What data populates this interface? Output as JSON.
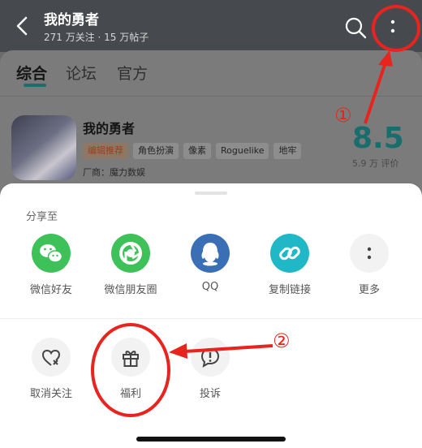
{
  "header": {
    "title": "我的勇者",
    "subtitle": "271 万关注 · 15 万帖子"
  },
  "tabs": [
    {
      "label": "综合"
    },
    {
      "label": "论坛"
    },
    {
      "label": "官方"
    }
  ],
  "game": {
    "title": "我的勇者",
    "tags": [
      "编辑推荐",
      "角色扮演",
      "像素",
      "Roguelike",
      "地牢"
    ],
    "developer": "厂商：魔力数娱",
    "score": "8.5",
    "rating_count": "5.9 万 评价"
  },
  "sheet": {
    "share_to_label": "分享至",
    "share_items": [
      {
        "label": "微信好友",
        "icon": "wechat-icon",
        "color": "#3fc15a"
      },
      {
        "label": "微信朋友圈",
        "icon": "moments-icon",
        "color": "#3fc15a"
      },
      {
        "label": "QQ",
        "icon": "qq-icon",
        "color": "#3a6fb5"
      },
      {
        "label": "复制链接",
        "icon": "link-icon",
        "color": "#20b7c7"
      },
      {
        "label": "更多",
        "icon": "more-icon",
        "color": "#f2f2f2"
      }
    ],
    "actions": [
      {
        "label": "取消关注",
        "icon": "unfollow-heart-icon"
      },
      {
        "label": "福利",
        "icon": "gift-icon"
      },
      {
        "label": "投诉",
        "icon": "report-icon"
      }
    ]
  },
  "annotations": {
    "marker_1": "①",
    "marker_2": "②",
    "color": "#e8241f"
  }
}
